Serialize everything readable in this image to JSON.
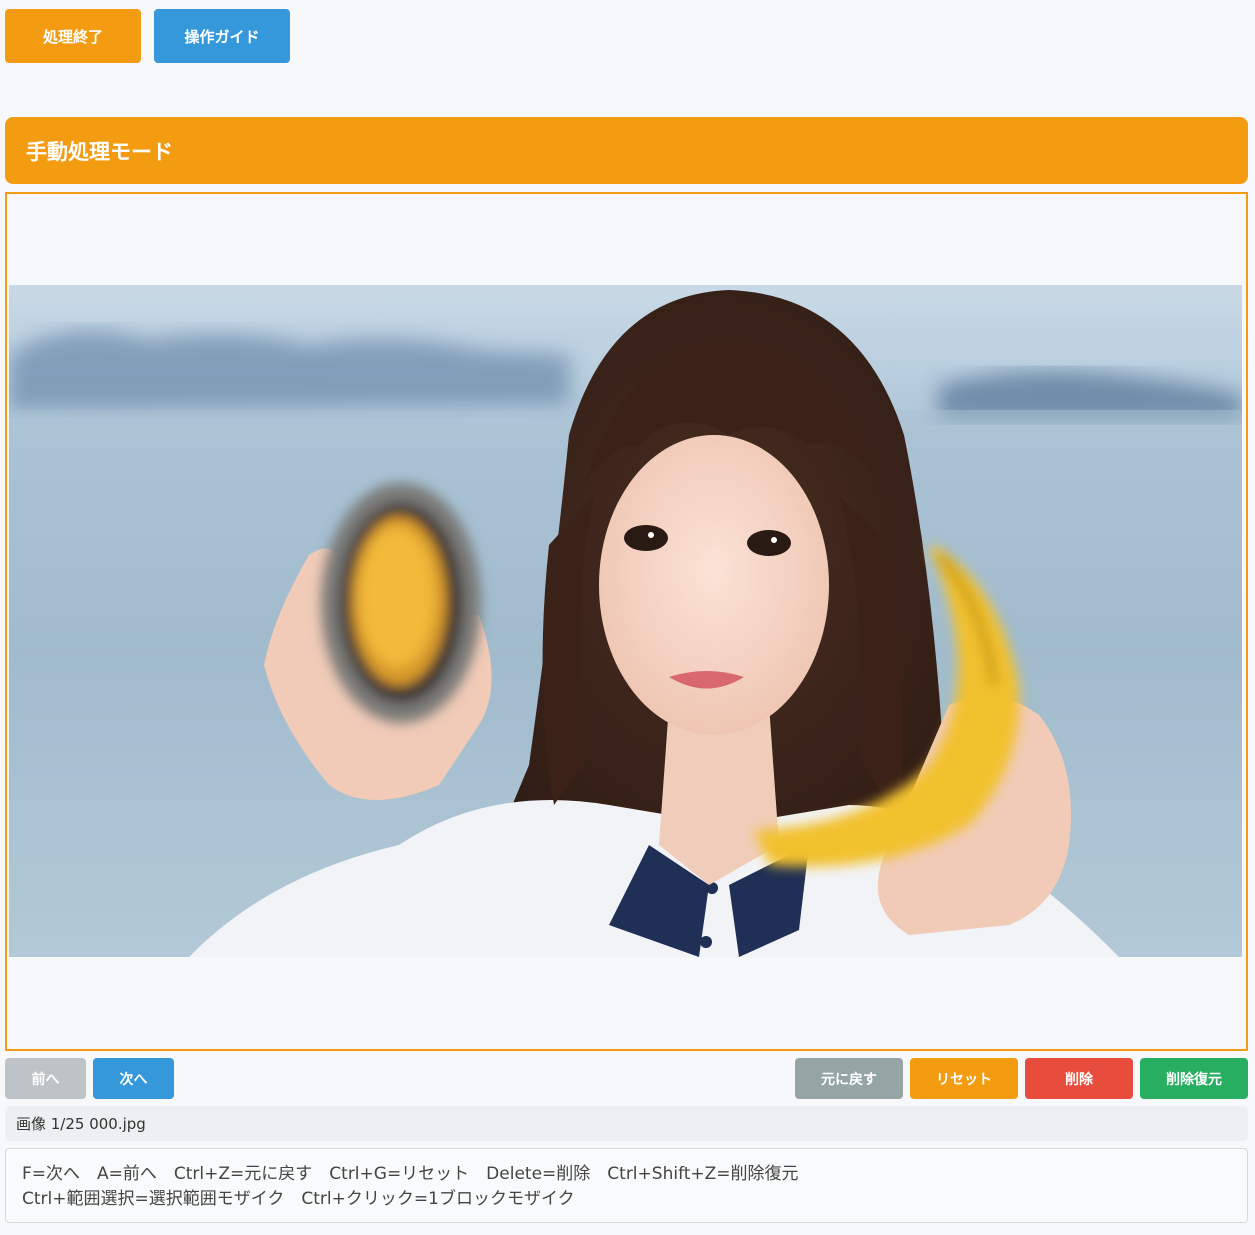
{
  "toolbar": {
    "finish_label": "処理終了",
    "guide_label": "操作ガイド"
  },
  "mode": {
    "title": "手動処理モード"
  },
  "nav": {
    "prev_label": "前へ",
    "next_label": "次へ",
    "undo_label": "元に戻す",
    "reset_label": "リセット",
    "delete_label": "削除",
    "restore_label": "削除復元"
  },
  "status": {
    "text": "画像 1/25 000.jpg"
  },
  "help": {
    "line1": "F=次へ　A=前へ　Ctrl+Z=元に戻す　Ctrl+G=リセット　Delete=削除　Ctrl+Shift+Z=削除復元",
    "line2": "Ctrl+範囲選択=選択範囲モザイク　Ctrl+クリック=1ブロックモザイク"
  },
  "colors": {
    "accent_orange": "#f39c12",
    "primary_blue": "#3498db",
    "neutral_gray": "#95a5a6",
    "danger_red": "#e74c3c",
    "success_green": "#27ae60"
  }
}
